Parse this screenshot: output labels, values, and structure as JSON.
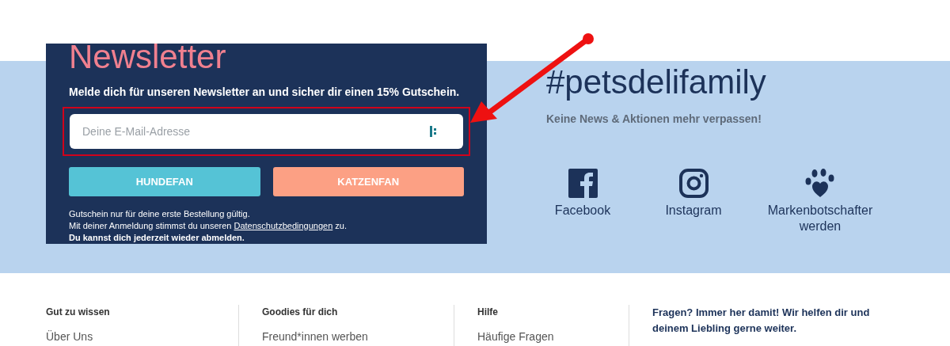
{
  "newsletter": {
    "title": "Newsletter",
    "subtitle": "Melde dich für unseren Newsletter an und sicher dir einen 15% Gutschein.",
    "email_field": {
      "placeholder": "Deine E-Mail-Adresse"
    },
    "buttons": [
      {
        "label": "HUNDEFAN",
        "color": "#55c3d6"
      },
      {
        "label": "KATZENFAN",
        "color": "#fca084"
      }
    ],
    "notes": [
      {
        "text": "Gutschein nur für deine erste Bestellung gültig.",
        "kind": "plain"
      },
      {
        "text": "Mit deiner Anmeldung stimmst du unseren ",
        "link": "Datenschutzbedingungen",
        "after": " zu.",
        "kind": "link"
      },
      {
        "text": "Du kannst dich jederzeit wieder abmelden.",
        "kind": "bold"
      }
    ]
  },
  "social": {
    "title": "#petsdelifamily",
    "subtitle": "Keine News & Aktionen mehr verpassen!",
    "links": [
      {
        "label": "Facebook",
        "kind": "facebook"
      },
      {
        "label": "Instagram",
        "kind": "instagram"
      },
      {
        "label": "Markenbotschafter werden",
        "kind": "paw"
      }
    ]
  },
  "footer": {
    "columns": [
      {
        "title": "Gut zu wissen",
        "links": [
          "Über Uns"
        ]
      },
      {
        "title": "Goodies für dich",
        "links": [
          "Freund*innen werben"
        ]
      },
      {
        "title": "Hilfe",
        "links": [
          "Häufige Fragen"
        ]
      }
    ],
    "contact": "Fragen? Immer her damit! Wir helfen dir und deinem Liebling gerne weiter."
  }
}
